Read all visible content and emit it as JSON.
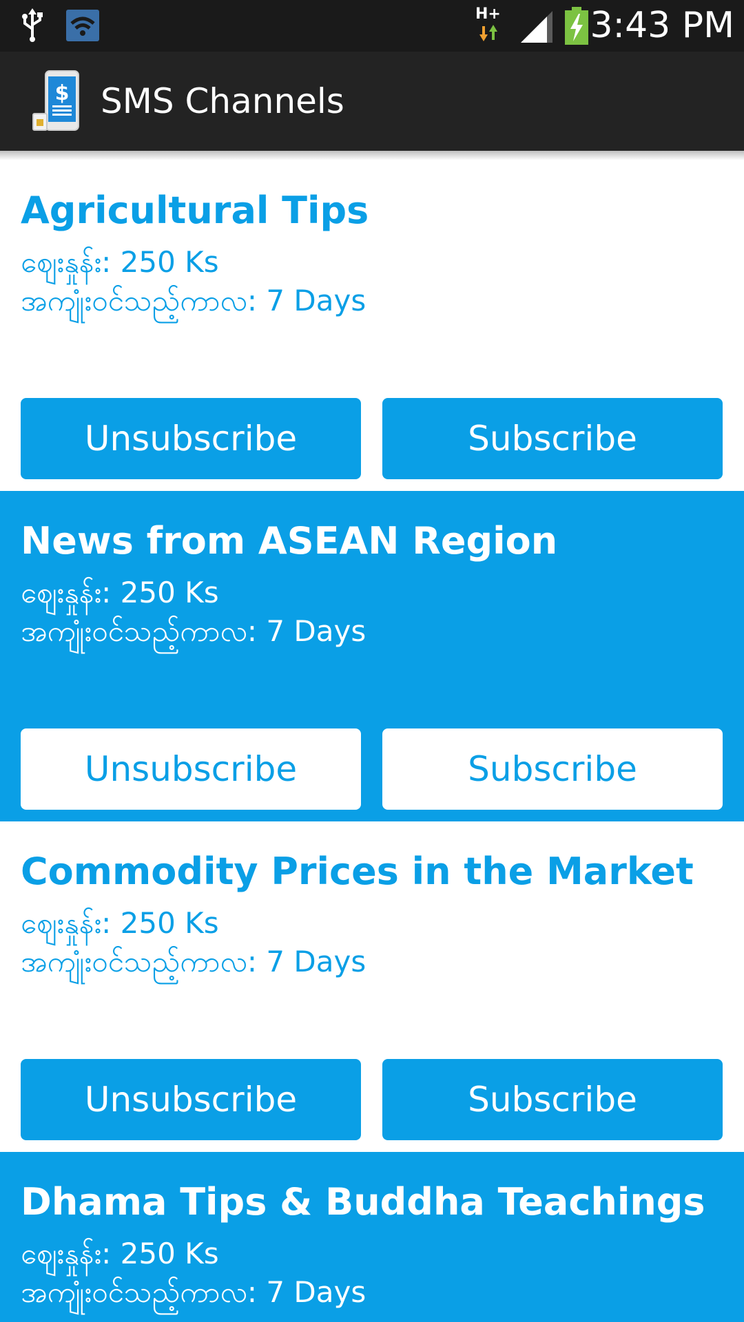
{
  "status_bar": {
    "network_type": "H+",
    "time": "3:43 PM",
    "icons": [
      "usb-icon",
      "wifi-notification-icon",
      "data-transfer-icon",
      "signal-strength-icon",
      "battery-charging-icon"
    ]
  },
  "action_bar": {
    "title": "SMS Channels",
    "icon": "sms-money-phone-icon"
  },
  "colors": {
    "accent": "#0a9fe6",
    "action_bar_bg": "#232323",
    "status_bar_bg": "#1a1a1a",
    "battery_green": "#7cc242"
  },
  "channels": [
    {
      "title": "Agricultural Tips",
      "price": "ဈေးနှုန်း: 250 Ks",
      "validity": "အကျုံးဝင်သည့်ကာလ: 7 Days",
      "unsubscribe_label": "Unsubscribe",
      "subscribe_label": "Subscribe"
    },
    {
      "title": "News from ASEAN Region",
      "price": "ဈေးနှုန်း: 250 Ks",
      "validity": "အကျုံးဝင်သည့်ကာလ: 7 Days",
      "unsubscribe_label": "Unsubscribe",
      "subscribe_label": "Subscribe"
    },
    {
      "title": "Commodity Prices in the Market",
      "price": "ဈေးနှုန်း: 250 Ks",
      "validity": "အကျုံးဝင်သည့်ကာလ: 7 Days",
      "unsubscribe_label": "Unsubscribe",
      "subscribe_label": "Subscribe"
    },
    {
      "title": "Dhama Tips & Buddha Teachings",
      "price": "ဈေးနှုန်း: 250 Ks",
      "validity": "အကျုံးဝင်သည့်ကာလ: 7 Days"
    }
  ]
}
